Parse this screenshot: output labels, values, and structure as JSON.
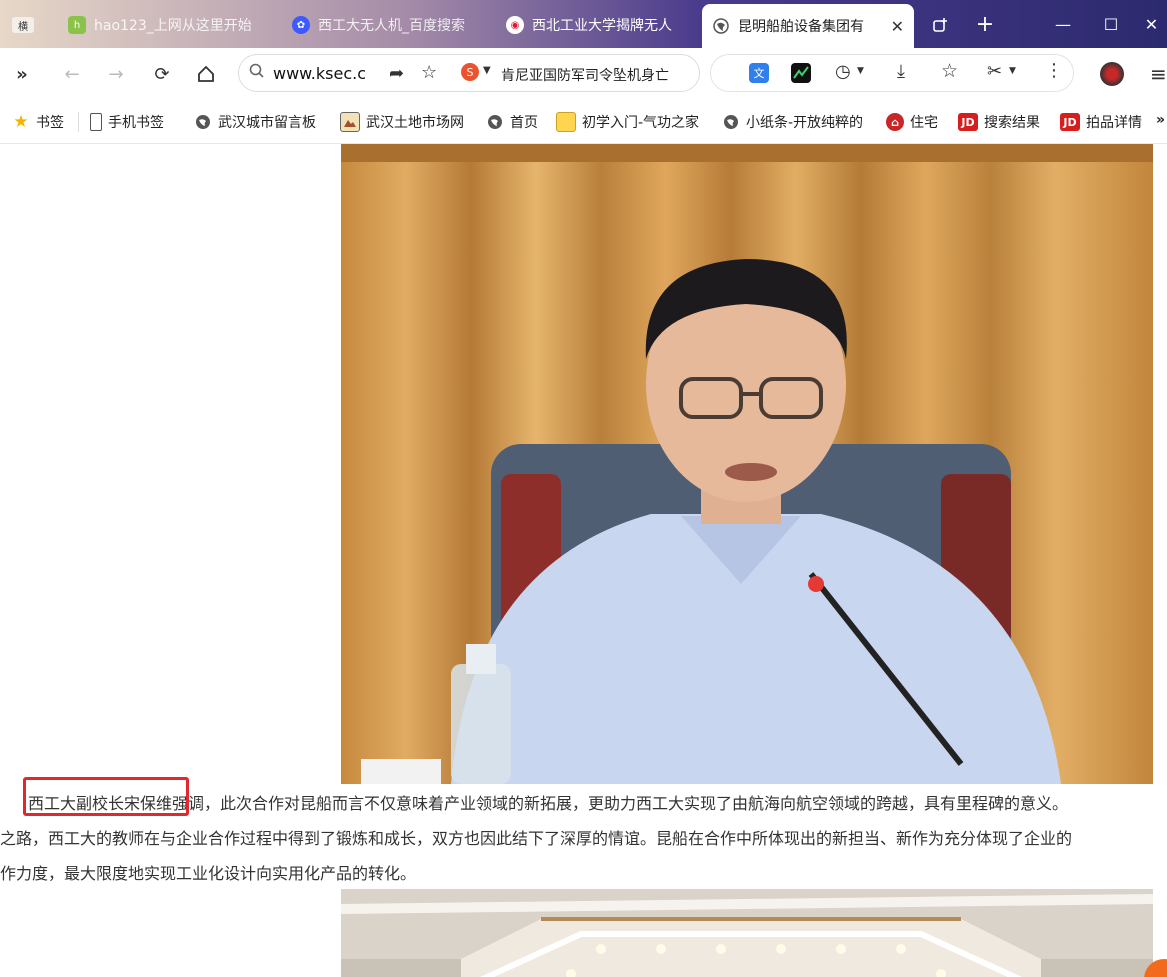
{
  "tabs": [
    {
      "label": "横",
      "pinned": true
    },
    {
      "label": "hao123_上网从这里开始",
      "icon": "hao123-icon"
    },
    {
      "label": "西工大无人机_百度搜索",
      "icon": "baidu-paw-icon"
    },
    {
      "label": "西北工业大学揭牌无人",
      "icon": "weibo-icon"
    },
    {
      "label": "昆明船舶设备集团有",
      "icon": "globe-icon",
      "active": true
    }
  ],
  "toolbar": {
    "url": "www.ksec.c",
    "suggestion": "肯尼亚国防军司令坠机身亡"
  },
  "bookmarks": [
    {
      "label": "书签",
      "icon": "star-icon"
    },
    {
      "label": "手机书签",
      "icon": "phone-icon"
    },
    {
      "label": "武汉城市留言板",
      "icon": "globe-icon"
    },
    {
      "label": "武汉土地市场网",
      "icon": "landscape-icon"
    },
    {
      "label": "首页",
      "icon": "globe-icon"
    },
    {
      "label": "初学入门-气功之家",
      "icon": "note-icon"
    },
    {
      "label": "小纸条-开放纯粹的",
      "icon": "globe-icon"
    },
    {
      "label": "住宅",
      "icon": "house-icon"
    },
    {
      "label": "搜索结果",
      "icon": "jd-icon",
      "badge": "JD"
    },
    {
      "label": "拍品详情",
      "icon": "jd-icon",
      "badge": "JD"
    }
  ],
  "article": {
    "highlight": "西工大副校长宋保维",
    "line1_rest": "强调，此次合作对昆船而言不仅意味着产业领域的新拓展，更助力西工大实现了由航海向航空领域的跨越，具有里程碑的意义。",
    "line2": "之路，西工大的教师在与企业合作过程中得到了锻炼和成长，双方也因此结下了深厚的情谊。昆船在合作中所体现出的新担当、新作为充分体现了企业的",
    "line3": "作力度，最大限度地实现工业化设计向实用化产品的转化。"
  },
  "colors": {
    "accent_red": "#e0282e",
    "text": "#333333"
  }
}
